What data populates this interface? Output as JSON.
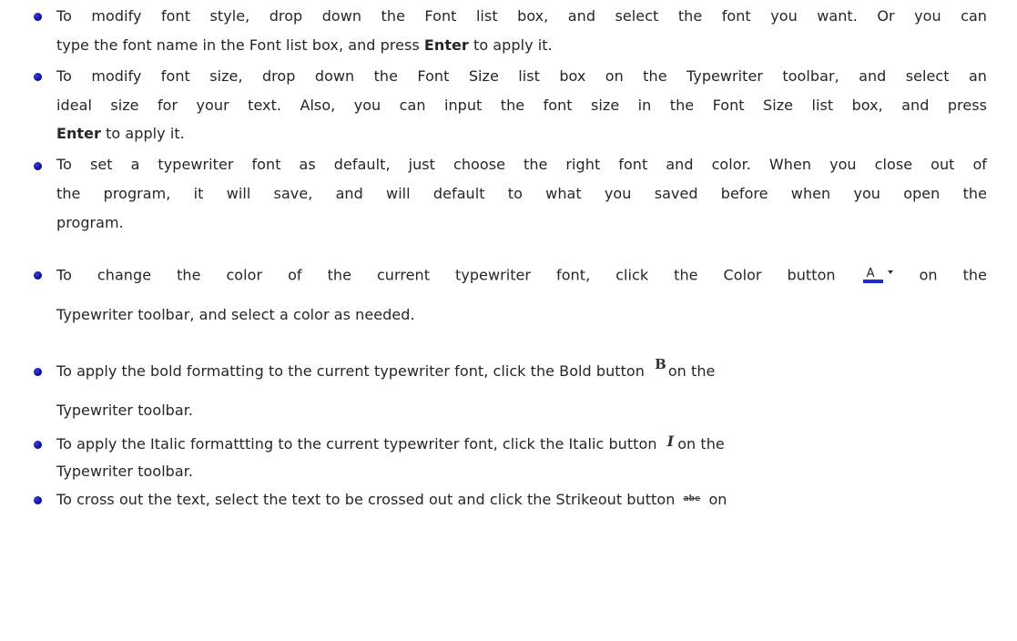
{
  "bullets": [
    {
      "lines": [
        "To modify font style, drop down the Font list box, and select the font you want. Or you can",
        "type the font name in the Font list box, and press ",
        "Enter",
        " to apply it."
      ]
    },
    {
      "lines": [
        "To modify font size, drop down the Font Size list box on the Typewriter toolbar, and select an",
        "ideal size for your text. Also, you can input the font size in the Font Size list box, and press",
        "Enter",
        " to apply it."
      ]
    },
    {
      "lines": [
        "To set a typewriter font as default, just choose the right font and color. When you close out of",
        "the program, it will save, and will default to what you saved before when you open the",
        "program."
      ]
    },
    {
      "lines": [
        "To change the color of the current typewriter font, click the Color button",
        "on the",
        "Typewriter toolbar, and select a color as needed."
      ],
      "icon": "font-color-icon",
      "icon_letter": "A"
    },
    {
      "lines": [
        "To apply the bold formatting to the current typewriter font, click the Bold button",
        "on the",
        "Typewriter toolbar."
      ],
      "icon": "bold-icon",
      "icon_letter": "B"
    },
    {
      "lines": [
        "To apply the Italic formattting to the current typewriter font, click the Italic button",
        "on the",
        "Typewriter toolbar."
      ],
      "icon": "italic-icon",
      "icon_letter": "I"
    },
    {
      "lines": [
        "To cross out the text, select the text to be crossed out and click the Strikeout button",
        "on"
      ],
      "icon": "strikeout-icon",
      "icon_letter": "abe"
    }
  ],
  "colors": {
    "text": "#262626",
    "bullet": "#0a0f9a",
    "color_icon_bar": "#1a2bd6"
  }
}
